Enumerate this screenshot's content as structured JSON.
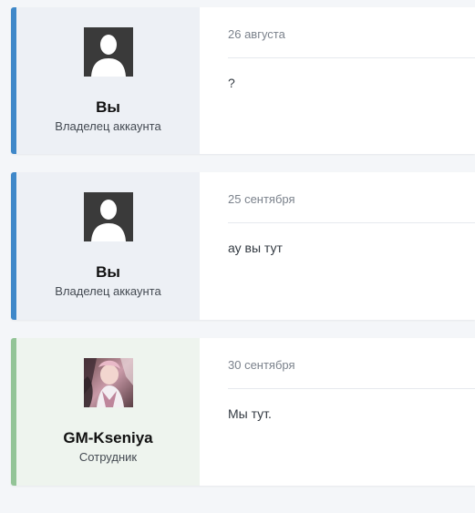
{
  "messages": [
    {
      "author": {
        "name": "Вы",
        "role": "Владелец аккаунта",
        "avatar_icon": "default-user-icon"
      },
      "date": "26 августа",
      "text": "?"
    },
    {
      "author": {
        "name": "Вы",
        "role": "Владелец аккаунта",
        "avatar_icon": "default-user-icon"
      },
      "date": "25 сентября",
      "text": "ау вы тут"
    },
    {
      "author": {
        "name": "GM-Kseniya",
        "role": "Сотрудник",
        "avatar_icon": "anime-character-avatar"
      },
      "date": "30 сентября",
      "text": "Мы тут."
    }
  ],
  "colors": {
    "user_accent": "#3f88c9",
    "staff_accent": "#93c497",
    "user_panel_bg": "#edf0f5",
    "staff_panel_bg": "#eef4ee",
    "page_bg": "#f4f6f9"
  }
}
